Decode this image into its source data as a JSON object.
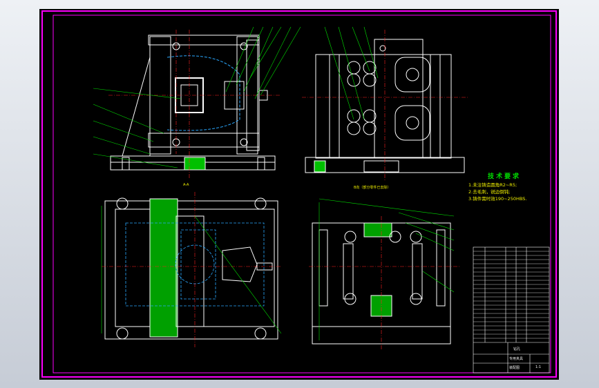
{
  "colors": {
    "background": "#000000",
    "frame": "#ff00ff",
    "outline": "#ffffff",
    "hidden": "#2aa8ff",
    "section_fill": "#00c000",
    "center_line": "#ff2020",
    "leader": "#00e000",
    "text": "#f0f000"
  },
  "technical_requirements": {
    "title": "技术要求",
    "items": [
      "1.未注铸造圆角R2~R5;",
      "2.去毛刺，锐边倒钝;",
      "3.铸件需时效190~250HBS."
    ]
  },
  "view_labels": {
    "section_a": "A-A",
    "exploded_note": "B向（部分零件已去除）"
  },
  "title_block": {
    "row1": "钻孔",
    "row2": "专用夹具",
    "row3": "装配图",
    "sheet": "1:1"
  }
}
